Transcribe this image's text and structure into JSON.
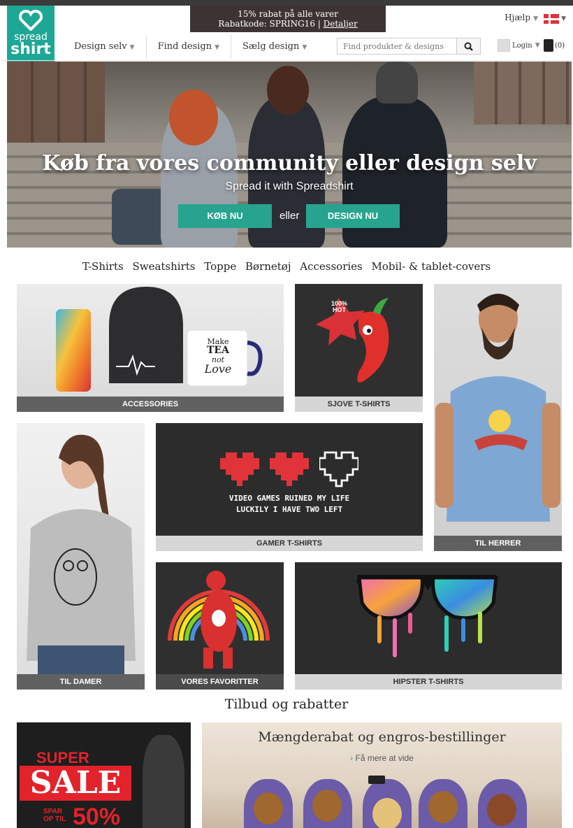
{
  "brand": {
    "line1": "spread",
    "line2": "shirt",
    "color": "#1fa795"
  },
  "promo": {
    "line1": "15% rabat på alle varer",
    "code_text": "Rabatkode: SPRING16 | ",
    "details_link": "Detaljer"
  },
  "topright": {
    "help": "Hjælp",
    "flag": "danish-flag-icon"
  },
  "nav": {
    "items": [
      "Design selv",
      "Find design",
      "Sælg design"
    ]
  },
  "search": {
    "placeholder": "Find produkter & designs",
    "icon": "search-icon"
  },
  "account": {
    "login": "Login",
    "cart_count": "(0)"
  },
  "hero": {
    "title": "Køb fra vores community eller design selv",
    "subtitle": "Spread it with Spreadshirt",
    "buy_button": "KØB NU",
    "or": "eller",
    "design_button": "DESIGN NU",
    "accent": "#27a490"
  },
  "categories": [
    "T-Shirts",
    "Sweatshirts",
    "Toppe",
    "Børnetøj",
    "Accessories",
    "Mobil- & tablet-covers"
  ],
  "tiles": {
    "accessories": "ACCESSORIES",
    "sjove": "SJOVE T-SHIRTS",
    "herrer": "TIL HERRER",
    "damer": "TIL DAMER",
    "gamer": "GAMER T-SHIRTS",
    "gamer_text_1": "VIDEO GAMES RUINED MY LIFE",
    "gamer_text_2": "LUCKILY I HAVE TWO LEFT",
    "favoritter": "VORES FAVORITTER",
    "hipster": "HIPSTER T-SHIRTS",
    "mug_line1": "Make",
    "mug_line2": "TEA",
    "mug_line3": "not",
    "mug_line4": "Love",
    "pepper_badge1": "100%",
    "pepper_badge2": "HOT"
  },
  "offers": {
    "title": "Tilbud og rabatter",
    "sale_super": "SUPER",
    "sale_big": "SALE",
    "sale_spar1": "SPAR",
    "sale_spar2": "OP TIL",
    "sale_pct": "50%",
    "bulk_title": "Mængderabat og engros-bestillinger",
    "bulk_more": "Få mere at vide"
  }
}
